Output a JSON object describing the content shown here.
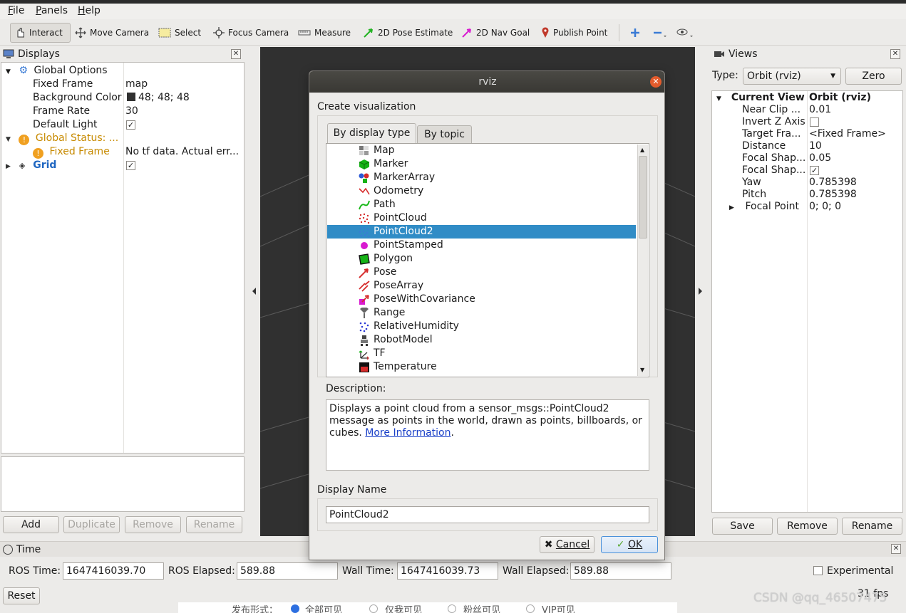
{
  "menu": [
    "File",
    "Panels",
    "Help"
  ],
  "toolbar": {
    "interact": "Interact",
    "move_camera": "Move Camera",
    "select": "Select",
    "focus_camera": "Focus Camera",
    "measure": "Measure",
    "pose_estimate": "2D Pose Estimate",
    "nav_goal": "2D Nav Goal",
    "publish_point": "Publish Point"
  },
  "displays": {
    "title": "Displays",
    "global_options": "Global Options",
    "fixed_frame_label": "Fixed Frame",
    "fixed_frame_value": "map",
    "bg_color_label": "Background Color",
    "bg_color_value": "48; 48; 48",
    "frame_rate_label": "Frame Rate",
    "frame_rate_value": "30",
    "default_light_label": "Default Light",
    "global_status_label": "Global Status: ...",
    "status_fixed_frame_label": "Fixed Frame",
    "status_fixed_frame_value": "No tf data.  Actual err...",
    "grid_label": "Grid",
    "buttons": {
      "add": "Add",
      "duplicate": "Duplicate",
      "remove": "Remove",
      "rename": "Rename"
    }
  },
  "views": {
    "title": "Views",
    "type_label": "Type:",
    "type_value": "Orbit (rviz)",
    "zero": "Zero",
    "current_view_label": "Current View",
    "current_view_value": "Orbit (rviz)",
    "props": [
      {
        "label": "Near Clip ...",
        "value": "0.01"
      },
      {
        "label": "Invert Z Axis",
        "value": ""
      },
      {
        "label": "Target Fra...",
        "value": "<Fixed Frame>"
      },
      {
        "label": "Distance",
        "value": "10"
      },
      {
        "label": "Focal Shap...",
        "value": "0.05"
      },
      {
        "label": "Focal Shap...",
        "value": ""
      },
      {
        "label": "Yaw",
        "value": "0.785398"
      },
      {
        "label": "Pitch",
        "value": "0.785398"
      },
      {
        "label": "Focal Point",
        "value": "0; 0; 0"
      }
    ],
    "buttons": {
      "save": "Save",
      "remove": "Remove",
      "rename": "Rename"
    }
  },
  "time": {
    "title": "Time",
    "ros_time_label": "ROS Time:",
    "ros_time_value": "1647416039.70",
    "ros_elapsed_label": "ROS Elapsed:",
    "ros_elapsed_value": "589.88",
    "wall_time_label": "Wall Time:",
    "wall_time_value": "1647416039.73",
    "wall_elapsed_label": "Wall Elapsed:",
    "wall_elapsed_value": "589.88",
    "experimental": "Experimental",
    "reset": "Reset",
    "fps": "31 fps"
  },
  "dialog": {
    "title": "rviz",
    "heading": "Create visualization",
    "tab_display_type": "By display type",
    "tab_topic": "By topic",
    "items": [
      "Map",
      "Marker",
      "MarkerArray",
      "Odometry",
      "Path",
      "PointCloud",
      "PointCloud2",
      "PointStamped",
      "Polygon",
      "Pose",
      "PoseArray",
      "PoseWithCovariance",
      "Range",
      "RelativeHumidity",
      "RobotModel",
      "TF",
      "Temperature"
    ],
    "selected": "PointCloud2",
    "description_label": "Description:",
    "description_text": "Displays a point cloud from a sensor_msgs::PointCloud2 message as points in the world, drawn as points, billboards, or cubes.",
    "more_info": "More Information",
    "display_name_label": "Display Name",
    "display_name_value": "PointCloud2",
    "cancel": "Cancel",
    "ok": "OK"
  },
  "background_page": [
    "发布形式：",
    "全部可见",
    "仅我可见",
    "粉丝可见",
    "VIP可见"
  ],
  "watermark": "CSDN @qq_46507475",
  "colors": {
    "accent": "#308cc6",
    "viewport": "#303030",
    "status_warn": "#c78a00",
    "link": "#1a40c8"
  }
}
